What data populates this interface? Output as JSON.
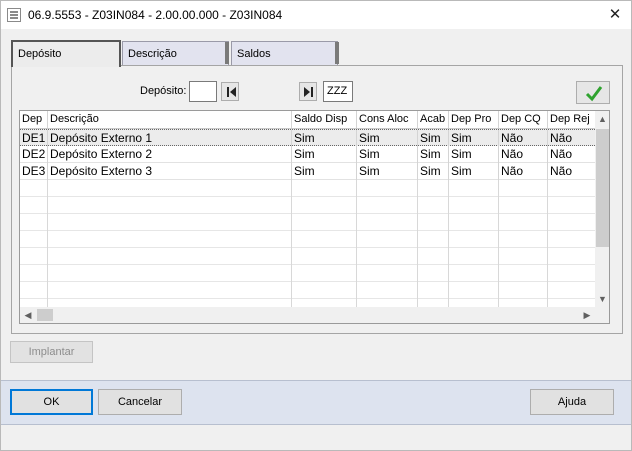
{
  "window": {
    "title": "06.9.5553 - Z03IN084 - 2.00.00.000 - Z03IN084",
    "close_glyph": "✕"
  },
  "tabs": [
    {
      "label": "Depósito",
      "active": true
    },
    {
      "label": "Descrição",
      "active": false
    },
    {
      "label": "Saldos",
      "active": false
    }
  ],
  "filter": {
    "deposito_label": "Depósito:",
    "deposito_value": "",
    "zzz_value": "ZZZ"
  },
  "grid": {
    "columns": [
      "Dep",
      "Descrição",
      "Saldo Disp",
      "Cons Aloc",
      "Acab",
      "Dep Pro",
      "Dep CQ",
      "Dep Rej"
    ],
    "rows": [
      [
        "DE1",
        "Depósito Externo 1",
        "Sim",
        "Sim",
        "Sim",
        "Sim",
        "Não",
        "Não"
      ],
      [
        "DE2",
        "Depósito Externo 2",
        "Sim",
        "Sim",
        "Sim",
        "Sim",
        "Não",
        "Não"
      ],
      [
        "DE3",
        "Depósito Externo 3",
        "Sim",
        "Sim",
        "Sim",
        "Sim",
        "Não",
        "Não"
      ]
    ],
    "selected_row": 0
  },
  "buttons": {
    "implantar": "Implantar",
    "ok": "OK",
    "cancelar": "Cancelar",
    "ajuda": "Ajuda"
  },
  "colors": {
    "bottom_bar": "#dde3ef",
    "check_green": "#2fa32f",
    "default_button_border": "#0078d7"
  }
}
